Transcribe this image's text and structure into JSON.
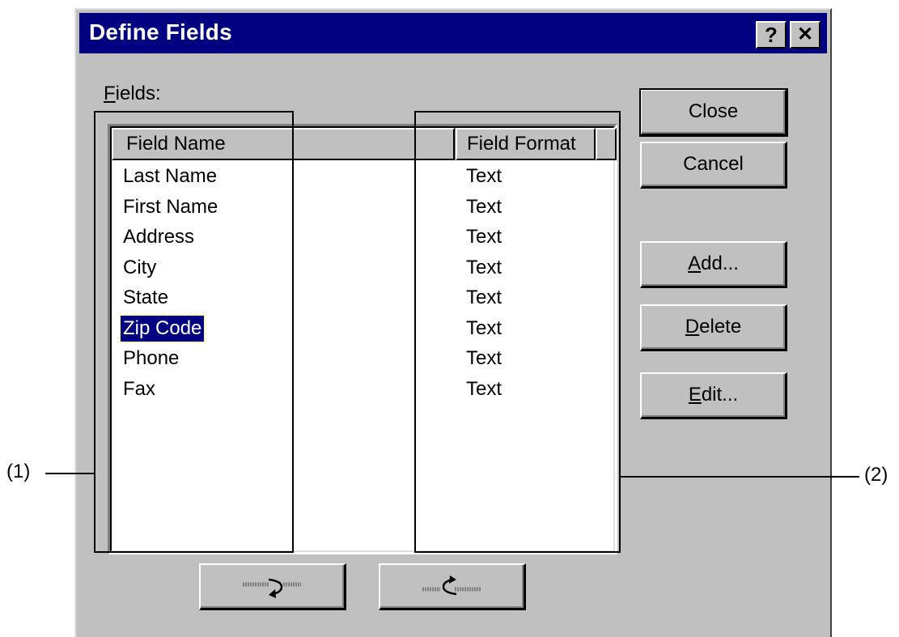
{
  "window": {
    "title": "Define Fields",
    "help_label": "?",
    "close_label": "✕",
    "titlebar_color": "#000080",
    "face_color": "#c0c0c0"
  },
  "fields_label": {
    "prefix": "F",
    "rest": "ields:"
  },
  "list": {
    "columns": [
      "Field Name",
      "Field Format"
    ],
    "rows": [
      {
        "name": "Last Name",
        "format": "Text"
      },
      {
        "name": "First Name",
        "format": "Text"
      },
      {
        "name": "Address",
        "format": "Text"
      },
      {
        "name": "City",
        "format": "Text"
      },
      {
        "name": "State",
        "format": "Text"
      },
      {
        "name": "Zip Code",
        "format": "Text",
        "selected": true
      },
      {
        "name": "Phone",
        "format": "Text"
      },
      {
        "name": "Fax",
        "format": "Text"
      }
    ]
  },
  "buttons": {
    "close": "Close",
    "cancel": "Cancel",
    "add": {
      "prefix": "A",
      "rest": "dd..."
    },
    "delete": {
      "prefix": "D",
      "rest": "elete"
    },
    "edit": {
      "prefix": "E",
      "rest": "dit..."
    }
  },
  "move_buttons": {
    "left_icon": "move-right-icon",
    "right_icon": "move-left-icon"
  },
  "callouts": {
    "left": "(1)",
    "right": "(2)"
  }
}
